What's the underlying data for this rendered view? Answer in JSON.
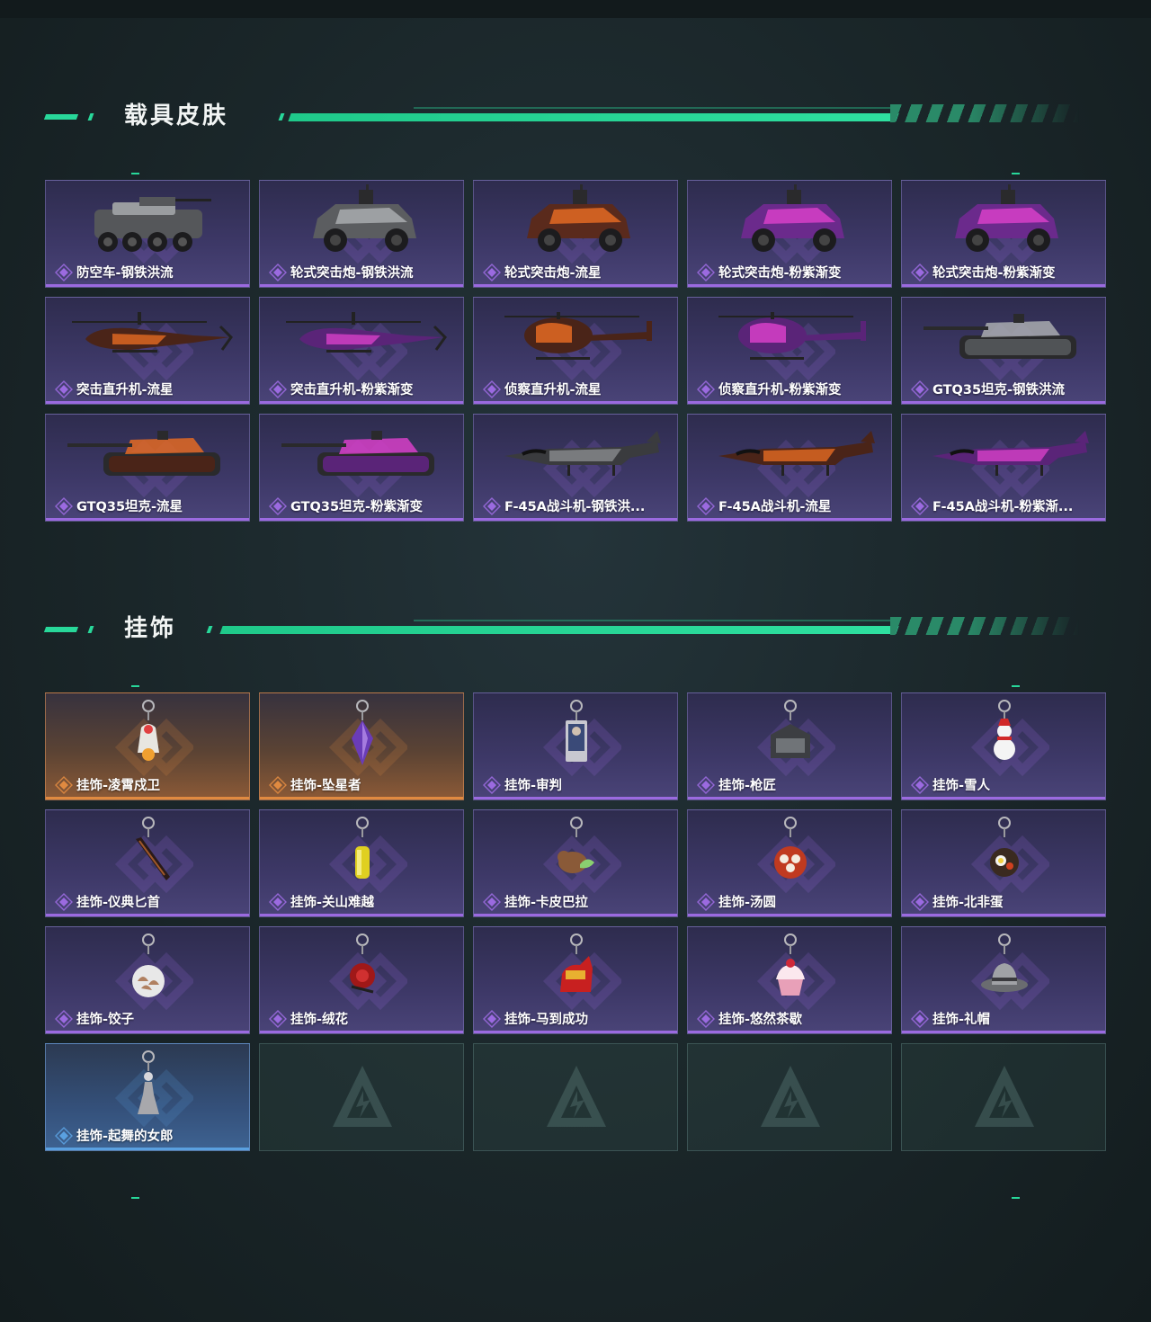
{
  "sections": {
    "vehicles": {
      "title": "载具皮肤",
      "items": [
        {
          "name": "防空车-钢铁洪流",
          "kind": "apc",
          "palette": {
            "body": "#55575a",
            "accent": "#9a9da0"
          }
        },
        {
          "name": "轮式突击炮-钢铁洪流",
          "kind": "jeep",
          "palette": {
            "body": "#5b5d60",
            "accent": "#a9acaf"
          }
        },
        {
          "name": "轮式突击炮-流星",
          "kind": "jeep",
          "palette": {
            "body": "#5a2a1c",
            "accent": "#e36a23"
          }
        },
        {
          "name": "轮式突击炮-粉紫渐变",
          "kind": "jeep",
          "palette": {
            "body": "#6b2a8c",
            "accent": "#d740c8"
          }
        },
        {
          "name": "轮式突击炮-粉紫渐变",
          "kind": "jeep",
          "palette": {
            "body": "#6b2a8c",
            "accent": "#d740c8"
          }
        },
        {
          "name": "突击直升机-流星",
          "kind": "attack-heli",
          "palette": {
            "body": "#4a2418",
            "accent": "#e36a23"
          }
        },
        {
          "name": "突击直升机-粉紫渐变",
          "kind": "attack-heli",
          "palette": {
            "body": "#5a2478",
            "accent": "#d740c8"
          }
        },
        {
          "name": "侦察直升机-流星",
          "kind": "scout-heli",
          "palette": {
            "body": "#4a2418",
            "accent": "#e36a23"
          }
        },
        {
          "name": "侦察直升机-粉紫渐变",
          "kind": "scout-heli",
          "palette": {
            "body": "#5a2478",
            "accent": "#d740c8"
          }
        },
        {
          "name": "GTQ35坦克-钢铁洪流",
          "kind": "tank",
          "palette": {
            "body": "#505356",
            "accent": "#a9acaf"
          }
        },
        {
          "name": "GTQ35坦克-流星",
          "kind": "tank",
          "palette": {
            "body": "#4a2418",
            "accent": "#e36a23"
          }
        },
        {
          "name": "GTQ35坦克-粉紫渐变",
          "kind": "tank",
          "palette": {
            "body": "#5a2478",
            "accent": "#d740c8"
          }
        },
        {
          "name": "F-45A战斗机-钢铁洪流",
          "display_name": "F-45A战斗机-钢铁洪...",
          "kind": "jet",
          "palette": {
            "body": "#3a3b3e",
            "accent": "#8a8c8f"
          }
        },
        {
          "name": "F-45A战斗机-流星",
          "kind": "jet",
          "palette": {
            "body": "#4a2418",
            "accent": "#e36a23"
          }
        },
        {
          "name": "F-45A战斗机-粉紫渐变",
          "display_name": "F-45A战斗机-粉紫渐...",
          "kind": "jet",
          "palette": {
            "body": "#5a2478",
            "accent": "#d740c8"
          }
        }
      ]
    },
    "charms": {
      "title": "挂饰",
      "items": [
        {
          "name": "挂饰-凌霄戍卫",
          "rarity": "orange",
          "kind": "figure",
          "palette": {
            "body": "#e8e6e0",
            "accent": "#f0a030"
          }
        },
        {
          "name": "挂饰-坠星者",
          "rarity": "orange",
          "kind": "crystal",
          "palette": {
            "body": "#6a3cb8",
            "accent": "#b48be8"
          }
        },
        {
          "name": "挂饰-审判",
          "rarity": "purple",
          "kind": "card",
          "palette": {
            "body": "#3a4a78",
            "accent": "#c8c8d0"
          }
        },
        {
          "name": "挂饰-枪匠",
          "rarity": "purple",
          "kind": "box",
          "palette": {
            "body": "#3c3e42",
            "accent": "#707478"
          }
        },
        {
          "name": "挂饰-雪人",
          "rarity": "purple",
          "kind": "snowman",
          "palette": {
            "body": "#f4f4f4",
            "accent": "#d02828"
          }
        },
        {
          "name": "挂饰-仪典匕首",
          "rarity": "purple",
          "kind": "dagger",
          "palette": {
            "body": "#2a1a18",
            "accent": "#a0582a"
          }
        },
        {
          "name": "挂饰-关山难越",
          "rarity": "purple",
          "kind": "bar",
          "palette": {
            "body": "#e0d020",
            "accent": "#f4ec80"
          }
        },
        {
          "name": "挂饰-卡皮巴拉",
          "rarity": "purple",
          "kind": "capybara",
          "palette": {
            "body": "#8a5a38",
            "accent": "#8ad070"
          }
        },
        {
          "name": "挂饰-汤圆",
          "rarity": "purple",
          "kind": "bowl",
          "palette": {
            "body": "#c03a20",
            "accent": "#f4ece0"
          }
        },
        {
          "name": "挂饰-北非蛋",
          "rarity": "purple",
          "kind": "pan",
          "palette": {
            "body": "#3a2a20",
            "accent": "#f0d040"
          }
        },
        {
          "name": "挂饰-饺子",
          "rarity": "purple",
          "kind": "plate",
          "palette": {
            "body": "#e8e8e8",
            "accent": "#b08060"
          }
        },
        {
          "name": "挂饰-绒花",
          "rarity": "purple",
          "kind": "flower",
          "palette": {
            "body": "#a01818",
            "accent": "#202020"
          }
        },
        {
          "name": "挂饰-马到成功",
          "rarity": "purple",
          "kind": "horse",
          "palette": {
            "body": "#c82020",
            "accent": "#e8b030"
          }
        },
        {
          "name": "挂饰-悠然茶歇",
          "rarity": "purple",
          "kind": "cupcake",
          "palette": {
            "body": "#e8a0b8",
            "accent": "#d02838"
          }
        },
        {
          "name": "挂饰-礼帽",
          "rarity": "purple",
          "kind": "hat",
          "palette": {
            "body": "#6a6c70",
            "accent": "#a0a2a6"
          }
        },
        {
          "name": "挂饰-起舞的女郎",
          "rarity": "blue",
          "kind": "dancer",
          "palette": {
            "body": "#a8a8ac",
            "accent": "#d8d8dc"
          }
        },
        {
          "empty": true
        },
        {
          "empty": true
        },
        {
          "empty": true
        },
        {
          "empty": true
        }
      ]
    }
  },
  "colors": {
    "accent": "#28d89a",
    "purple": "#9b6ae0",
    "orange": "#e08a40",
    "blue": "#5aa0e0"
  }
}
